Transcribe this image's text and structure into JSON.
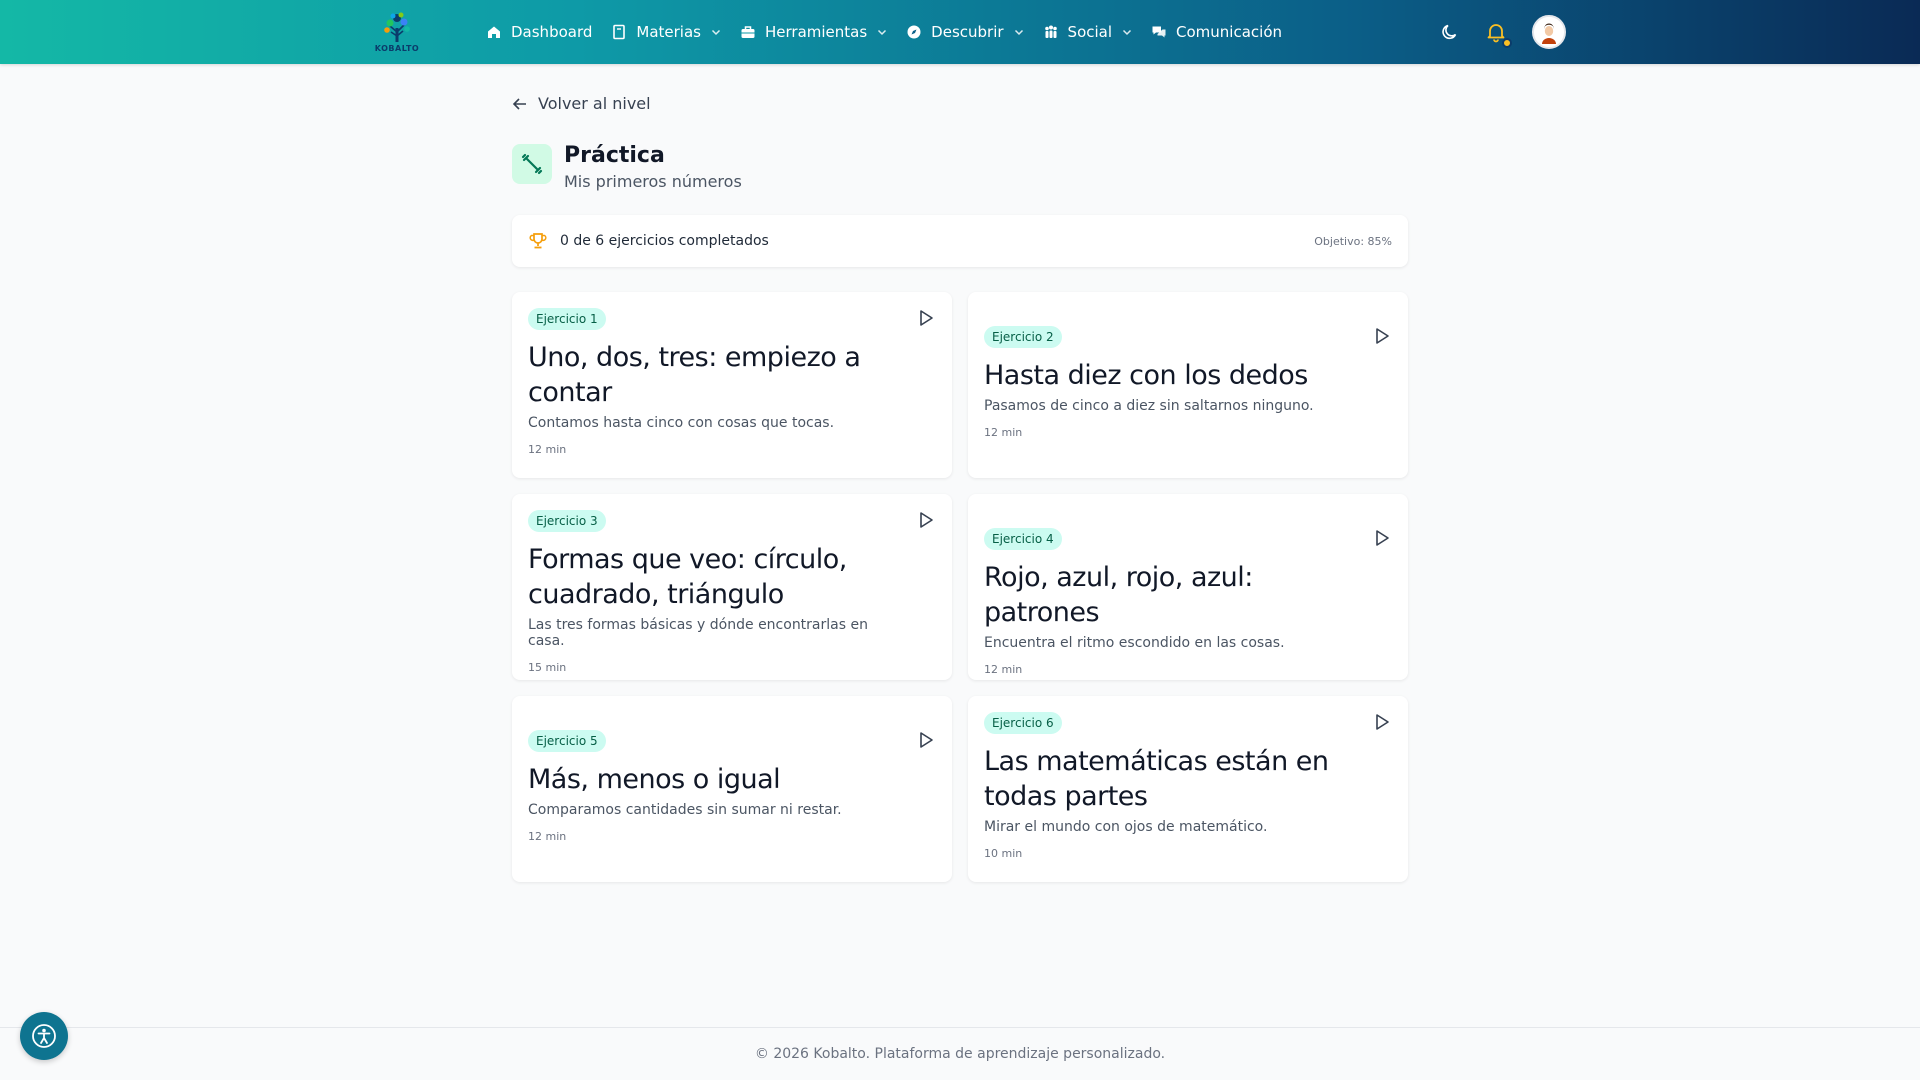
{
  "nav": {
    "logo_text": "KOBALTO",
    "items": [
      {
        "label": "Dashboard",
        "icon": "home-icon",
        "dropdown": false
      },
      {
        "label": "Materias",
        "icon": "book-icon",
        "dropdown": true
      },
      {
        "label": "Herramientas",
        "icon": "briefcase-icon",
        "dropdown": true
      },
      {
        "label": "Descubrir",
        "icon": "compass-icon",
        "dropdown": true
      },
      {
        "label": "Social",
        "icon": "users-icon",
        "dropdown": true
      },
      {
        "label": "Comunicación",
        "icon": "chat-icon",
        "dropdown": false
      }
    ]
  },
  "page": {
    "back_label": "Volver al nivel",
    "title": "Práctica",
    "subtitle": "Mis primeros números"
  },
  "progress": {
    "text": "0 de 6 ejercicios completados",
    "goal": "Objetivo: 85%"
  },
  "exercises": [
    {
      "badge": "Ejercicio 1",
      "title": "Uno, dos, tres: empiezo a contar",
      "desc": "Contamos hasta cinco con cosas que tocas.",
      "time": "12 min"
    },
    {
      "badge": "Ejercicio 2",
      "title": "Hasta diez con los dedos",
      "desc": "Pasamos de cinco a diez sin saltarnos ninguno.",
      "time": "12 min"
    },
    {
      "badge": "Ejercicio 3",
      "title": "Formas que veo: círculo, cuadrado, triángulo",
      "desc": "Las tres formas básicas y dónde encontrarlas en casa.",
      "time": "15 min"
    },
    {
      "badge": "Ejercicio 4",
      "title": "Rojo, azul, rojo, azul: patrones",
      "desc": "Encuentra el ritmo escondido en las cosas.",
      "time": "12 min"
    },
    {
      "badge": "Ejercicio 5",
      "title": "Más, menos o igual",
      "desc": "Comparamos cantidades sin sumar ni restar.",
      "time": "12 min"
    },
    {
      "badge": "Ejercicio 6",
      "title": "Las matemáticas están en todas partes",
      "desc": "Mirar el mundo con ojos de matemático.",
      "time": "10 min"
    }
  ],
  "footer": {
    "text": "© 2026 Kobalto. Plataforma de aprendizaje personalizado."
  },
  "colors": {
    "accent": "#14b8a6",
    "badge_bg": "#ccfbf1",
    "bell": "#fbbf24"
  }
}
